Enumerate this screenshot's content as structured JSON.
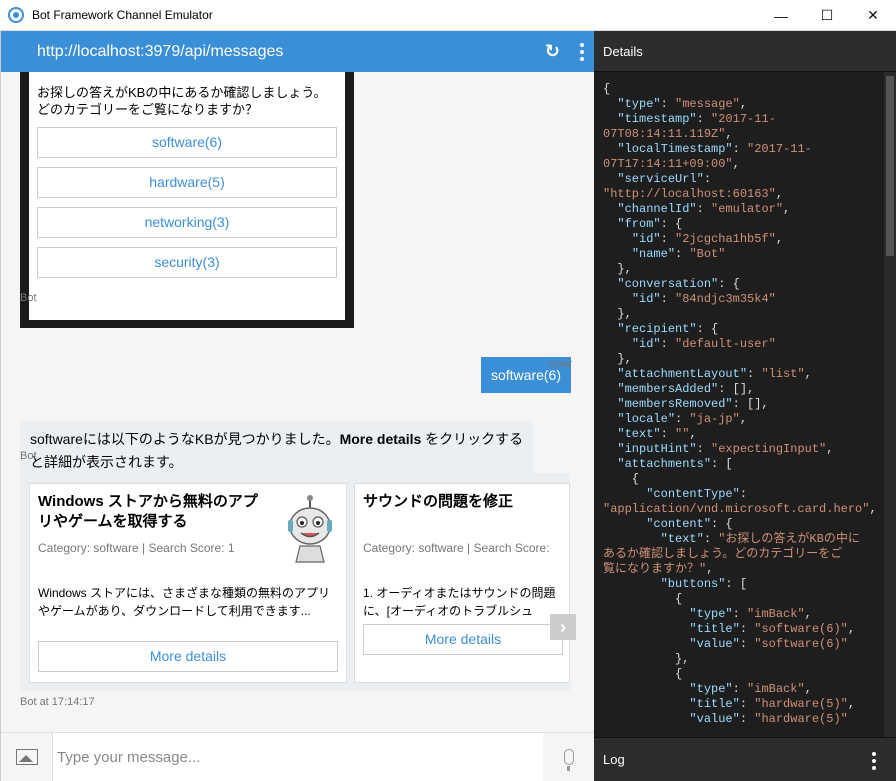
{
  "window": {
    "title": "Bot Framework Channel Emulator",
    "minimize_glyph": "—",
    "maximize_glyph": "☐",
    "close_glyph": "✕"
  },
  "chat": {
    "endpoint_url": "http://localhost:3979/api/messages",
    "refresh_glyph": "↻",
    "hero_card": {
      "text_line1": "お探しの答えがKBの中にあるか確認しましょう。",
      "text_line2": "どのカテゴリーをご覧になりますか？",
      "buttons": [
        "software(6)",
        "hardware(5)",
        "networking(3)",
        "security(3)"
      ]
    },
    "bot_label_1": "Bot",
    "user_message": "software(6)",
    "user_label": "User",
    "bot_message_pre": "softwareには以下のようなKBが見つかりました。",
    "bot_message_bold": "More details",
    "bot_message_post": " をクリックすると詳細が表示されます。",
    "bot_label_2": "Bot",
    "carousel": {
      "cards": [
        {
          "title": "Windows ストアから無料のアプリやゲームを取得する",
          "subtitle": "Category: software | Search Score: 1",
          "body": "Windows ストアには、さまざまな種類の無料のアプリやゲームがあり、ダウンロードして利用できます...",
          "button": "More details"
        },
        {
          "title": "サウンドの問題を修正",
          "subtitle": "Category: software | Search Score: ",
          "body": "1. オーディオまたはサウンドの問題",
          "body2": "に、[オーディオのトラブルシュ",
          "button": "More details"
        }
      ],
      "next_glyph": "›"
    },
    "bot_timestamp_label": "Bot at 17:14:17",
    "input": {
      "placeholder": "Type your message...",
      "value": ""
    }
  },
  "details": {
    "header": "Details",
    "log_header": "Log",
    "json_lines": [
      [
        [
          "p",
          "{"
        ]
      ],
      [
        [
          "p",
          "  "
        ],
        [
          "k",
          "\"type\""
        ],
        [
          "p",
          ": "
        ],
        [
          "s",
          "\"message\""
        ],
        [
          "p",
          ","
        ]
      ],
      [
        [
          "p",
          "  "
        ],
        [
          "k",
          "\"timestamp\""
        ],
        [
          "p",
          ": "
        ],
        [
          "s",
          "\"2017-11-"
        ]
      ],
      [
        [
          "s",
          "07T08:14:11.119Z\""
        ],
        [
          "p",
          ","
        ]
      ],
      [
        [
          "p",
          "  "
        ],
        [
          "k",
          "\"localTimestamp\""
        ],
        [
          "p",
          ": "
        ],
        [
          "s",
          "\"2017-11-"
        ]
      ],
      [
        [
          "s",
          "07T17:14:11+09:00\""
        ],
        [
          "p",
          ","
        ]
      ],
      [
        [
          "p",
          "  "
        ],
        [
          "k",
          "\"serviceUrl\""
        ],
        [
          "p",
          ":"
        ]
      ],
      [
        [
          "s",
          "\"http://localhost:60163\""
        ],
        [
          "p",
          ","
        ]
      ],
      [
        [
          "p",
          "  "
        ],
        [
          "k",
          "\"channelId\""
        ],
        [
          "p",
          ": "
        ],
        [
          "s",
          "\"emulator\""
        ],
        [
          "p",
          ","
        ]
      ],
      [
        [
          "p",
          "  "
        ],
        [
          "k",
          "\"from\""
        ],
        [
          "p",
          ": {"
        ]
      ],
      [
        [
          "p",
          "    "
        ],
        [
          "k",
          "\"id\""
        ],
        [
          "p",
          ": "
        ],
        [
          "s",
          "\"2jcgcha1hb5f\""
        ],
        [
          "p",
          ","
        ]
      ],
      [
        [
          "p",
          "    "
        ],
        [
          "k",
          "\"name\""
        ],
        [
          "p",
          ": "
        ],
        [
          "s",
          "\"Bot\""
        ]
      ],
      [
        [
          "p",
          "  },"
        ]
      ],
      [
        [
          "p",
          "  "
        ],
        [
          "k",
          "\"conversation\""
        ],
        [
          "p",
          ": {"
        ]
      ],
      [
        [
          "p",
          "    "
        ],
        [
          "k",
          "\"id\""
        ],
        [
          "p",
          ": "
        ],
        [
          "s",
          "\"84ndjc3m35k4\""
        ]
      ],
      [
        [
          "p",
          "  },"
        ]
      ],
      [
        [
          "p",
          "  "
        ],
        [
          "k",
          "\"recipient\""
        ],
        [
          "p",
          ": {"
        ]
      ],
      [
        [
          "p",
          "    "
        ],
        [
          "k",
          "\"id\""
        ],
        [
          "p",
          ": "
        ],
        [
          "s",
          "\"default-user\""
        ]
      ],
      [
        [
          "p",
          "  },"
        ]
      ],
      [
        [
          "p",
          "  "
        ],
        [
          "k",
          "\"attachmentLayout\""
        ],
        [
          "p",
          ": "
        ],
        [
          "s",
          "\"list\""
        ],
        [
          "p",
          ","
        ]
      ],
      [
        [
          "p",
          "  "
        ],
        [
          "k",
          "\"membersAdded\""
        ],
        [
          "p",
          ": [],"
        ]
      ],
      [
        [
          "p",
          "  "
        ],
        [
          "k",
          "\"membersRemoved\""
        ],
        [
          "p",
          ": [],"
        ]
      ],
      [
        [
          "p",
          "  "
        ],
        [
          "k",
          "\"locale\""
        ],
        [
          "p",
          ": "
        ],
        [
          "s",
          "\"ja-jp\""
        ],
        [
          "p",
          ","
        ]
      ],
      [
        [
          "p",
          "  "
        ],
        [
          "k",
          "\"text\""
        ],
        [
          "p",
          ": "
        ],
        [
          "s",
          "\"\""
        ],
        [
          "p",
          ","
        ]
      ],
      [
        [
          "p",
          "  "
        ],
        [
          "k",
          "\"inputHint\""
        ],
        [
          "p",
          ": "
        ],
        [
          "s",
          "\"expectingInput\""
        ],
        [
          "p",
          ","
        ]
      ],
      [
        [
          "p",
          "  "
        ],
        [
          "k",
          "\"attachments\""
        ],
        [
          "p",
          ": ["
        ]
      ],
      [
        [
          "p",
          "    {"
        ]
      ],
      [
        [
          "p",
          "      "
        ],
        [
          "k",
          "\"contentType\""
        ],
        [
          "p",
          ":"
        ]
      ],
      [
        [
          "s",
          "\"application/vnd.microsoft.card.hero\""
        ],
        [
          "p",
          ","
        ]
      ],
      [
        [
          "p",
          "      "
        ],
        [
          "k",
          "\"content\""
        ],
        [
          "p",
          ": {"
        ]
      ],
      [
        [
          "p",
          "        "
        ],
        [
          "k",
          "\"text\""
        ],
        [
          "p",
          ": "
        ],
        [
          "s",
          "\"お探しの答えがKBの中に"
        ]
      ],
      [
        [
          "s",
          "あるか確認しましょう。どのカテゴリーをご"
        ]
      ],
      [
        [
          "s",
          "覧になりますか？\""
        ],
        [
          "p",
          ","
        ]
      ],
      [
        [
          "p",
          "        "
        ],
        [
          "k",
          "\"buttons\""
        ],
        [
          "p",
          ": ["
        ]
      ],
      [
        [
          "p",
          "          {"
        ]
      ],
      [
        [
          "p",
          "            "
        ],
        [
          "k",
          "\"type\""
        ],
        [
          "p",
          ": "
        ],
        [
          "s",
          "\"imBack\""
        ],
        [
          "p",
          ","
        ]
      ],
      [
        [
          "p",
          "            "
        ],
        [
          "k",
          "\"title\""
        ],
        [
          "p",
          ": "
        ],
        [
          "s",
          "\"software(6)\""
        ],
        [
          "p",
          ","
        ]
      ],
      [
        [
          "p",
          "            "
        ],
        [
          "k",
          "\"value\""
        ],
        [
          "p",
          ": "
        ],
        [
          "s",
          "\"software(6)\""
        ]
      ],
      [
        [
          "p",
          "          },"
        ]
      ],
      [
        [
          "p",
          "          {"
        ]
      ],
      [
        [
          "p",
          "            "
        ],
        [
          "k",
          "\"type\""
        ],
        [
          "p",
          ": "
        ],
        [
          "s",
          "\"imBack\""
        ],
        [
          "p",
          ","
        ]
      ],
      [
        [
          "p",
          "            "
        ],
        [
          "k",
          "\"title\""
        ],
        [
          "p",
          ": "
        ],
        [
          "s",
          "\"hardware(5)\""
        ],
        [
          "p",
          ","
        ]
      ],
      [
        [
          "p",
          "            "
        ],
        [
          "k",
          "\"value\""
        ],
        [
          "p",
          ": "
        ],
        [
          "s",
          "\"hardware(5)\""
        ]
      ]
    ]
  }
}
